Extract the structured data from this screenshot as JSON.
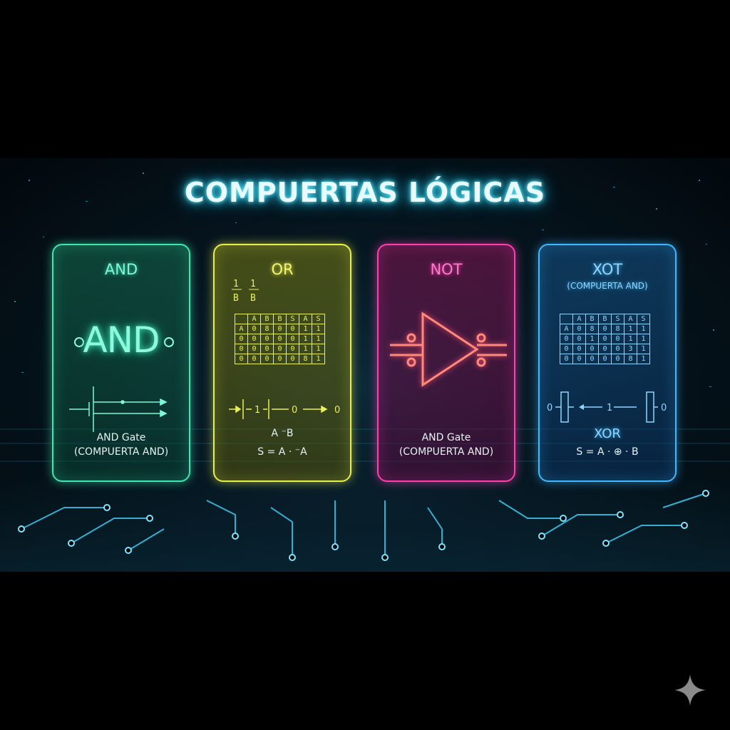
{
  "title": "COMPUERTAS LÓGICAS",
  "cards": [
    {
      "heading": "AND",
      "symbol_text": "AND",
      "caption_line1": "AND Gate",
      "caption_line2": "(COMPUERTA AND)",
      "accent": "#3fe6b0"
    },
    {
      "heading": "OR",
      "header_marks": [
        "1",
        "B",
        "1",
        "B"
      ],
      "truth_table": [
        [
          "",
          "A",
          "B",
          "B",
          "S",
          "A",
          "S"
        ],
        [
          "A",
          "0",
          "8",
          "0",
          "0",
          "1",
          "1"
        ],
        [
          "0",
          "0",
          "0",
          "0",
          "0",
          "1",
          "1"
        ],
        [
          "0",
          "0",
          "0",
          "0",
          "0",
          "1",
          "1"
        ],
        [
          "0",
          "0",
          "0",
          "0",
          "0",
          "8",
          "1"
        ]
      ],
      "wire_labels": [
        "1",
        "0",
        "0"
      ],
      "caption_line1": "A ⁻B",
      "caption_line2": "S = A · ⁻A",
      "accent": "#e8ee4a"
    },
    {
      "heading": "NOT",
      "caption_line1": "AND Gate",
      "caption_line2": "(COMPUERTA AND)",
      "accent": "#ff3fb0"
    },
    {
      "heading": "XOT",
      "subheading": "(COMPUERTA AND)",
      "truth_table": [
        [
          "",
          "A",
          "B",
          "B",
          "S",
          "A",
          "S"
        ],
        [
          "A",
          "0",
          "8",
          "0",
          "8",
          "1",
          "1"
        ],
        [
          "0",
          "0",
          "1",
          "0",
          "0",
          "1",
          "1"
        ],
        [
          "0",
          "0",
          "0",
          "0",
          "0",
          "3",
          "1"
        ],
        [
          "0",
          "0",
          "0",
          "0",
          "0",
          "8",
          "1"
        ]
      ],
      "wire_labels": [
        "0",
        "1",
        "0"
      ],
      "caption_line1": "XOR",
      "caption_line2": "S = A · ⊕ · B",
      "accent": "#3fb8ff"
    }
  ],
  "icons": [
    "sparkle-icon"
  ]
}
